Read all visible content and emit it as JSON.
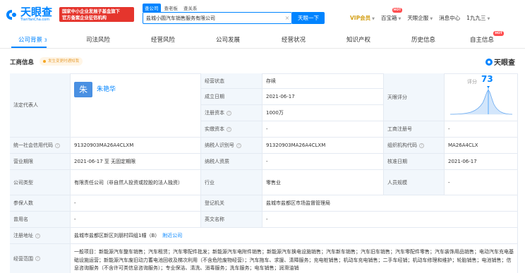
{
  "header": {
    "logo_cn": "天眼查",
    "logo_en": "TianYanCha.com",
    "gov_badge_line1": "国家中小企业发展子基金旗下",
    "gov_badge_line2": "官方备案企业征信机构",
    "search_tabs": [
      "查公司",
      "查老板",
      "查关系"
    ],
    "search_value": "盐城小圆汽车销售服务有限公司",
    "search_button": "天眼一下",
    "nav": {
      "vip": "VIP会员",
      "bao": "百宝箱",
      "enterprise": "天眼企服",
      "messages": "消息中心",
      "user": "1九九三",
      "hot": "HOT"
    }
  },
  "tabs": {
    "items": [
      {
        "label": "公司背景",
        "count": "3"
      },
      {
        "label": "司法风险"
      },
      {
        "label": "经营风险"
      },
      {
        "label": "公司发展"
      },
      {
        "label": "经营状况"
      },
      {
        "label": "知识产权"
      },
      {
        "label": "历史信息"
      },
      {
        "label": "自主信息"
      }
    ],
    "hot": "HOT"
  },
  "section": {
    "title": "工商信息",
    "notify": "发生变更时通知我",
    "brand": "天眼查"
  },
  "info": {
    "legal_rep_label": "法定代表人",
    "legal_rep_avatar": "朱",
    "legal_rep_name": "朱艳华",
    "status_label": "经营状态",
    "status_value": "存续",
    "found_label": "成立日期",
    "found_value": "2021-06-17",
    "capital_label": "注册资本",
    "capital_value": "1000万",
    "paid_label": "实缴资本",
    "paid_value": "-",
    "score_label": "天眼评分",
    "score_title": "评分",
    "score_value": "73",
    "biz_reg_label": "工商注册号",
    "biz_reg_value": "-",
    "credit_label": "统一社会信用代码",
    "credit_value": "91320903MA26A4CLXM",
    "taxpayer_label": "纳税人识别号",
    "taxpayer_value": "91320903MA26A4CLXM",
    "org_code_label": "组织机构代码",
    "org_code_value": "MA26A4CLX",
    "term_label": "营业期限",
    "term_value": "2021-06-17 至 无固定期限",
    "tax_qual_label": "纳税人资质",
    "tax_qual_value": "-",
    "approve_label": "核准日期",
    "approve_value": "2021-06-17",
    "type_label": "公司类型",
    "type_value": "有限责任公司（非自然人投资或控股的法人独资）",
    "industry_label": "行业",
    "industry_value": "零售业",
    "staff_label": "人员规模",
    "staff_value": "-",
    "insured_label": "参保人数",
    "insured_value": "-",
    "authority_label": "登记机关",
    "authority_value": "盐城市盐都区市场监督管理局",
    "former_label": "曾用名",
    "former_value": "-",
    "en_name_label": "英文名称",
    "en_name_value": "-",
    "address_label": "注册地址",
    "address_value": "盐城市盐都区新区刘朋村四组1幢（B）",
    "address_link": "附近公司",
    "scope_label": "经营范围",
    "scope_value": "一般项目：新能源汽车整车销售；汽车租赁；汽车零配件批发；新能源汽车电附件销售；新能源汽车换电设施销售；汽车新车销售；汽车旧车销售；汽车零配件零售；汽车装饰用品销售；电动汽车充电基础设施运营；新能源汽车废旧动力蓄电池回收及梯次利用（不含危险废物经营）；汽车拖车、求援、清障服务；充电桩销售；机动车充电销售；二手车经销；机动车修理和维护；轮胎销售；电池销售；信息咨询服务（不含许可类信息咨询服务）；专业保洁、清洗、消毒服务；洗车服务；电车销售；润滑油销"
  },
  "colors": {
    "accent": "#0084ff",
    "label_bg": "#f2f7fc",
    "badge_red": "#e5352d",
    "vip_gold": "#d4a017"
  }
}
